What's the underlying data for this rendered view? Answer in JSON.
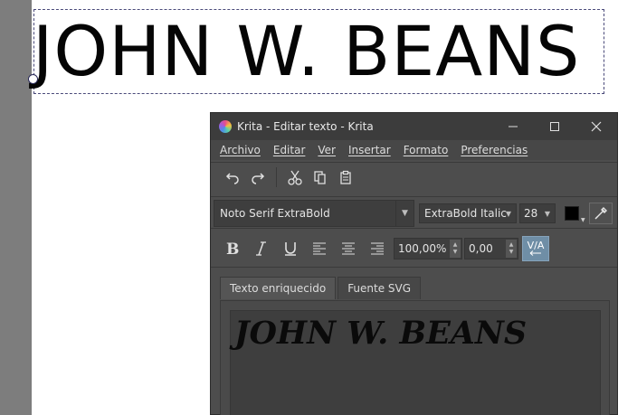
{
  "canvas": {
    "text": "JOHN W. BEANS"
  },
  "window": {
    "title": "Krita - Editar texto - Krita",
    "buttons": {
      "minimize": "minimize-icon",
      "maximize": "maximize-icon",
      "close": "close-icon"
    }
  },
  "menu": {
    "items": [
      "Archivo",
      "Editar",
      "Ver",
      "Insertar",
      "Formato",
      "Preferencias"
    ]
  },
  "toolbar": {
    "icons": [
      "undo-icon",
      "redo-icon",
      "cut-icon",
      "copy-icon",
      "paste-icon"
    ]
  },
  "font": {
    "family": "Noto Serif ExtraBold",
    "style": "ExtraBold Italic",
    "size": "28",
    "color": "#000000"
  },
  "format": {
    "line_height": "100,00%",
    "letter_spacing": "0,00",
    "kerning_label": "V/A"
  },
  "tabs": {
    "rich_text": "Texto enriquecido",
    "svg_source": "Fuente SVG",
    "active": "rich_text"
  },
  "editor": {
    "content": "JOHN W. BEANS"
  },
  "colors": {
    "accent": "#6f8ea6",
    "dialog_bg": "#4d4d4d",
    "titlebar_bg": "#3c3c3c",
    "canvas_strip": "#7d7d7d"
  }
}
